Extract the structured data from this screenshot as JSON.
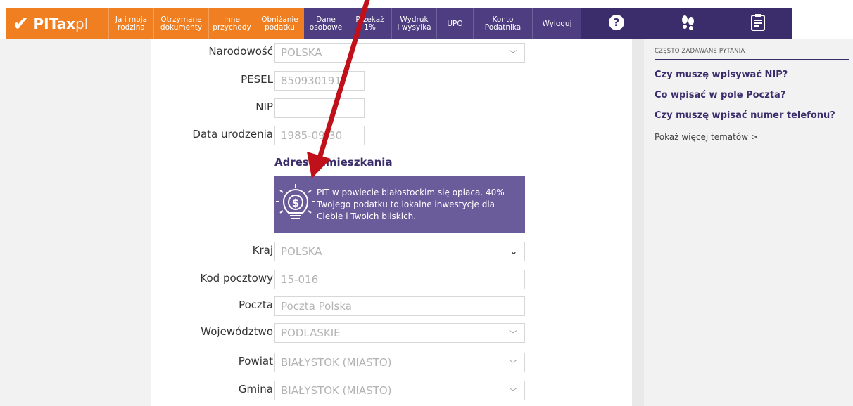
{
  "logo": {
    "brand": "PITax",
    "suffix": "pl"
  },
  "nav": [
    {
      "label1": "Ja i moja",
      "label2": "rodzina",
      "style": "orange",
      "width": 64
    },
    {
      "label1": "Otrzymane",
      "label2": "dokumenty",
      "style": "orange",
      "width": 78
    },
    {
      "label1": "Inne",
      "label2": "przychody",
      "style": "orange",
      "width": 66
    },
    {
      "label1": "Obniżanie",
      "label2": "podatku",
      "style": "orange",
      "width": 70
    },
    {
      "label1": "Dane",
      "label2": "osobowe",
      "style": "active",
      "width": 62
    },
    {
      "label1": "Przekaż",
      "label2": "1%",
      "style": "purple",
      "width": 62
    },
    {
      "label1": "Wydruk",
      "label2": "i wysyłka",
      "style": "purple",
      "width": 64
    },
    {
      "label1": "UPO",
      "label2": "",
      "style": "purple",
      "width": 52
    },
    {
      "label1": "Konto",
      "label2": "Podatnika",
      "style": "purple",
      "width": 84
    },
    {
      "label1": "Wyloguj",
      "label2": "",
      "style": "purple",
      "width": 70
    }
  ],
  "form": {
    "narodowosc_label": "Narodowość",
    "narodowosc_value": "POLSKA",
    "pesel_label": "PESEL",
    "pesel_value": "850930191",
    "nip_label": "NIP",
    "nip_value": "",
    "data_label": "Data urodzenia",
    "data_value": "1985-09-30",
    "section_title": "Adres zamieszkania",
    "promo_text": "PIT w powiecie białostockim się opłaca. 40% Twojego podatku to lokalne inwestycje dla Ciebie i Twoich bliskich.",
    "kraj_label": "Kraj",
    "kraj_value": "POLSKA",
    "kod_label": "Kod pocztowy",
    "kod_value": "15-016",
    "poczta_label": "Poczta",
    "poczta_value": "Poczta Polska",
    "woj_label": "Województwo",
    "woj_value": "PODLASKIE",
    "powiat_label": "Powiat",
    "powiat_value": "BIAŁYSTOK (MIASTO)",
    "gmina_label": "Gmina",
    "gmina_value": "BIAŁYSTOK (MIASTO)"
  },
  "help": {
    "header": "CZĘSTO ZADAWANE PYTANIA",
    "questions": [
      "Czy muszę wpisywać NIP?",
      "Co wpisać w pole Poczta?",
      "Czy muszę wpisać numer telefonu?"
    ],
    "more": "Pokaż więcej tematów >"
  },
  "colors": {
    "orange": "#f07f22",
    "purple": "#4f3d82",
    "dark_purple": "#3b2c6b",
    "promo": "#6a5b9b",
    "arrow": "#c0101a"
  }
}
